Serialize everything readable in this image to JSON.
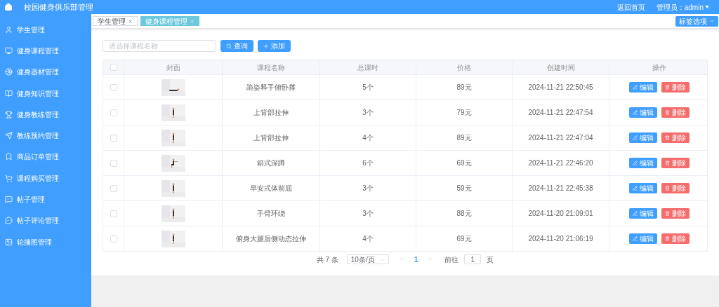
{
  "header": {
    "title": "校园健身俱乐部管理",
    "home_link": "返回首页",
    "user": "管理员：admin"
  },
  "sidebar": {
    "items": [
      {
        "label": "学生管理",
        "selected": false
      },
      {
        "label": "健身课程管理",
        "selected": false
      },
      {
        "label": "健身器材管理",
        "selected": false
      },
      {
        "label": "健身知识管理",
        "selected": false
      },
      {
        "label": "健身教练管理",
        "selected": false
      },
      {
        "label": "教练预约管理",
        "selected": false
      },
      {
        "label": "商品订单管理",
        "selected": false
      },
      {
        "label": "课程购买管理",
        "selected": false
      },
      {
        "label": "帖子管理",
        "selected": false
      },
      {
        "label": "帖子评论管理",
        "selected": false
      },
      {
        "label": "轮播图管理",
        "selected": false
      }
    ]
  },
  "tabs": [
    {
      "label": "学生管理",
      "selected": false
    },
    {
      "label": "健身课程管理",
      "selected": true
    }
  ],
  "tag_options": "标签选项",
  "search": {
    "placeholder": "请选择课程名称",
    "search_button": "查询",
    "add_button": "添加"
  },
  "table": {
    "select_all_checked": false,
    "columns": [
      "封面",
      "课程名称",
      "总课时",
      "价格",
      "创建时间",
      "操作"
    ],
    "rows": [
      {
        "checked": false,
        "name": "跪姿释手俯卧撑",
        "hours": "5个",
        "price": "89元",
        "created": "2024-11-21 22:50:45",
        "edit": "编辑",
        "delete": "删除"
      },
      {
        "checked": false,
        "name": "上背部拉伸",
        "hours": "3个",
        "price": "79元",
        "created": "2024-11-21 22:47:54",
        "edit": "编辑",
        "delete": "删除"
      },
      {
        "checked": false,
        "name": "上背部拉伸",
        "hours": "4个",
        "price": "89元",
        "created": "2024-11-21 22:47:04",
        "edit": "编辑",
        "delete": "删除"
      },
      {
        "checked": false,
        "name": "箱式深蹲",
        "hours": "6个",
        "price": "69元",
        "created": "2024-11-21 22:46:20",
        "edit": "编辑",
        "delete": "删除"
      },
      {
        "checked": false,
        "name": "早安式体前屈",
        "hours": "3个",
        "price": "59元",
        "created": "2024-11-21 22:45:38",
        "edit": "编辑",
        "delete": "删除"
      },
      {
        "checked": false,
        "name": "手臂环绕",
        "hours": "3个",
        "price": "88元",
        "created": "2024-11-20 21:09:01",
        "edit": "编辑",
        "delete": "删除"
      },
      {
        "checked": false,
        "name": "俯身大腿后侧动态拉伸",
        "hours": "4个",
        "price": "69元",
        "created": "2024-11-20 21:06:19",
        "edit": "编辑",
        "delete": "删除"
      }
    ]
  },
  "pagination": {
    "total": "共 7 条",
    "page_size": "10条/页",
    "pages": [
      {
        "label": "1",
        "selected": true
      }
    ],
    "goto_label": "前往",
    "goto_value": "1",
    "goto_suffix": "页"
  }
}
